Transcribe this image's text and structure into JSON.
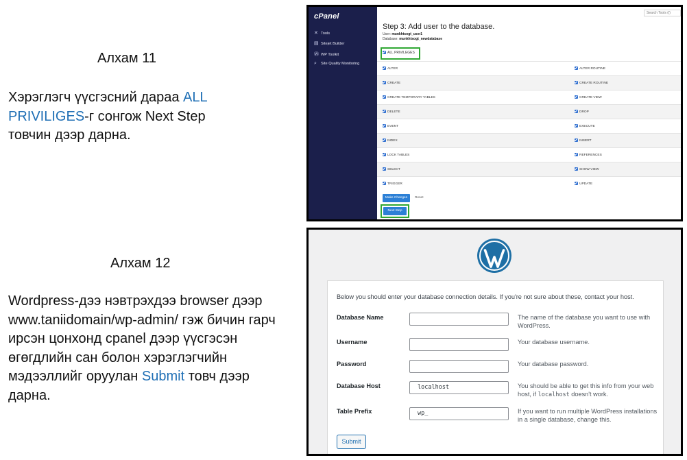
{
  "step11": {
    "title": "Алхам 11",
    "text_before": "Хэрэглэгч үүсгэсний дараа ",
    "highlight": "ALL PRIVILIGES",
    "text_after": "-г сонгож Next Step товчин дээр дарна."
  },
  "step12": {
    "title": "Алхам 12",
    "text_before": "Wordpress-дээ нэвтрэхдээ browser дээр www.taniidomain/wp-admin/ гэж бичин гарч ирсэн цонхонд cpanel дээр үүсгэсэн өгөгдлийн сан болон хэрэглэгчийн мэдээллийг оруулан ",
    "highlight": "Submit",
    "text_after": " товч дээр дарна."
  },
  "cpanel": {
    "logo": "cPanel",
    "search_placeholder": "Search Tools (/)",
    "nav": [
      {
        "label": "Tools",
        "icon": "tools-icon"
      },
      {
        "label": "Sitejet Builder",
        "icon": "sitejet-icon"
      },
      {
        "label": "WP Toolkit",
        "icon": "wordpress-icon"
      },
      {
        "label": "Site Quality Monitoring",
        "icon": "search-icon"
      }
    ],
    "heading": "Step 3: Add user to the database.",
    "user_label": "User:",
    "user_value": "munkhtsogt_user1",
    "database_label": "Database:",
    "database_value": "munkhtsogt_newdatabase",
    "all_privileges": "ALL PRIVILEGES",
    "privileges": [
      [
        "ALTER",
        "ALTER ROUTINE"
      ],
      [
        "CREATE",
        "CREATE ROUTINE"
      ],
      [
        "CREATE TEMPORARY TABLES",
        "CREATE VIEW"
      ],
      [
        "DELETE",
        "DROP"
      ],
      [
        "EVENT",
        "EXECUTE"
      ],
      [
        "INDEX",
        "INSERT"
      ],
      [
        "LOCK TABLES",
        "REFERENCES"
      ],
      [
        "SELECT",
        "SHOW VIEW"
      ],
      [
        "TRIGGER",
        "UPDATE"
      ]
    ],
    "make_changes": "Make Changes",
    "reset": "Reset",
    "next_step": "Next Step",
    "highlight_color": "#2fa733",
    "sidebar_color": "#1b1f4b",
    "button_color": "#2c80d6"
  },
  "wordpress": {
    "intro": "Below you should enter your database connection details. If you're not sure about these, contact your host.",
    "fields": [
      {
        "label": "Database Name",
        "value": "",
        "help": "The name of the database you want to use with WordPress."
      },
      {
        "label": "Username",
        "value": "",
        "help": "Your database username."
      },
      {
        "label": "Password",
        "value": "",
        "help": "Your database password."
      },
      {
        "label": "Database Host",
        "value": "localhost",
        "help_before": "You should be able to get this info from your web host, if ",
        "help_code": "localhost",
        "help_after": " doesn't work."
      },
      {
        "label": "Table Prefix",
        "value": "wp_",
        "help": "If you want to run multiple WordPress installations in a single database, change this."
      }
    ],
    "submit": "Submit",
    "logo_color": "#1e6fa5"
  }
}
